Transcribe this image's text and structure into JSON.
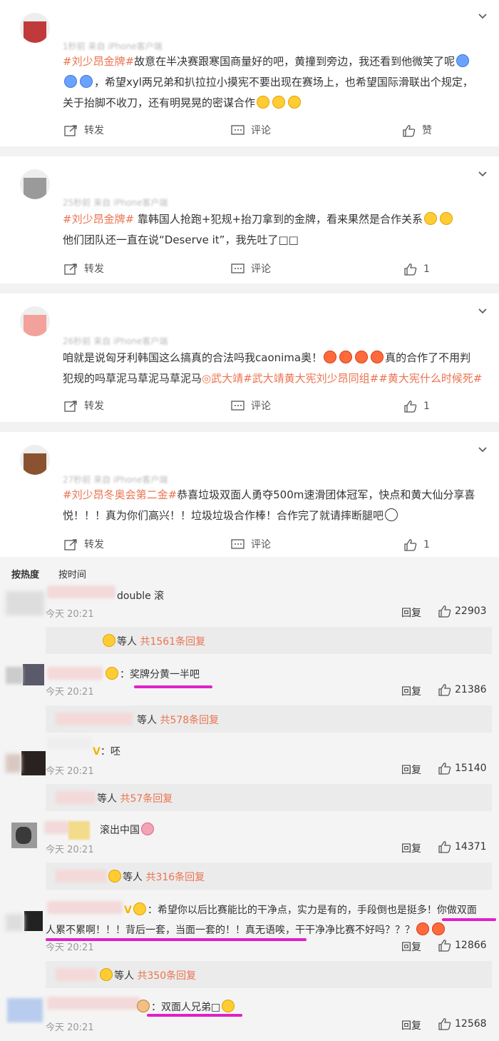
{
  "posts": [
    {
      "meta": "1秒前 来自 iPhone客户端",
      "line1_tag": "#刘少昂金牌#",
      "line1_text": "故意在半决赛跟寒国商量好的吧，黄撞到旁边，我还看到他微笑了呢",
      "line2_text": "，希望xyl两兄弟和扒拉拉小摸宪不要出现在赛场上，也希望国际滑联出个规定，",
      "line3_text": "关于抬脚不收刀，还有明晃晃的密谋合作",
      "share_label": "转发",
      "comment_label": "评论",
      "like_label": "赞"
    },
    {
      "meta": "25秒前 来自 iPhone客户端",
      "line1_tag": "#刘少昂金牌#",
      "line1_text": " 靠韩国人抢跑+犯规+抬刀拿到的金牌，看来果然是合作关系",
      "line2_text": "他们团队还一直在说“Deserve it”，我先吐了□□",
      "share_label": "转发",
      "comment_label": "评论",
      "like_count": "1"
    },
    {
      "meta": "26秒前 来自 iPhone客户端",
      "line1_text": "咱就是说匈牙利韩国这么搞真的合法吗我caonima奥！",
      "line1_tail": "真的合作了不用判",
      "line2_text": "犯规的吗草泥马草泥马草泥马",
      "line2_tags": "武大靖#武大靖黄大宪刘少昂同组##黄大宪什么时候死#",
      "share_label": "转发",
      "comment_label": "评论",
      "like_count": "1"
    },
    {
      "meta": "27秒前 来自 iPhone客户端",
      "line1_tag": "#刘少昂冬奥会第二金#",
      "line1_text": "恭喜垃圾双面人勇夺500m速滑团体冠军，快点和黄大仙分享喜",
      "line2_text": "悦！！！真为你们高兴！！垃圾垃圾合作棒！合作完了就请摔断腿吧",
      "share_label": "转发",
      "comment_label": "评论",
      "like_count": "1"
    }
  ],
  "sort": {
    "hot": "按热度",
    "time": "按时间"
  },
  "comments": [
    {
      "text": "double 滚",
      "time": "今天 20:21",
      "reply": "回复",
      "likes": "22903",
      "sub_suffix": "等人",
      "sub_count": "共1561条回复"
    },
    {
      "text": "：奖牌分黄一半吧",
      "time": "今天 20:21",
      "reply": "回复",
      "likes": "21386",
      "sub_suffix": "等人",
      "sub_count": "共578条回复"
    },
    {
      "text": "：呸",
      "badge": "V",
      "time": "今天 20:21",
      "reply": "回复",
      "likes": "15140",
      "sub_suffix": "等人",
      "sub_count": "共57条回复"
    },
    {
      "text": "滚出中国",
      "time": "今天 20:21",
      "reply": "回复",
      "likes": "14371",
      "sub_suffix": "等人",
      "sub_count": "共316条回复"
    },
    {
      "text": "：希望你以后比赛能比的干净点，实力是有的，手段倒也是挺多！你做双面",
      "text2": "人累不累啊！！！背后一套，当面一套的！！真无语唉，干干净净比赛不好吗？？？",
      "badge": "V",
      "time": "今天 20:21",
      "reply": "回复",
      "likes": "12866",
      "sub_suffix": "等人",
      "sub_count": "共350条回复"
    },
    {
      "text": "：双面人兄弟□",
      "time": "今天 20:21",
      "reply": "回复",
      "likes": "12568"
    }
  ]
}
